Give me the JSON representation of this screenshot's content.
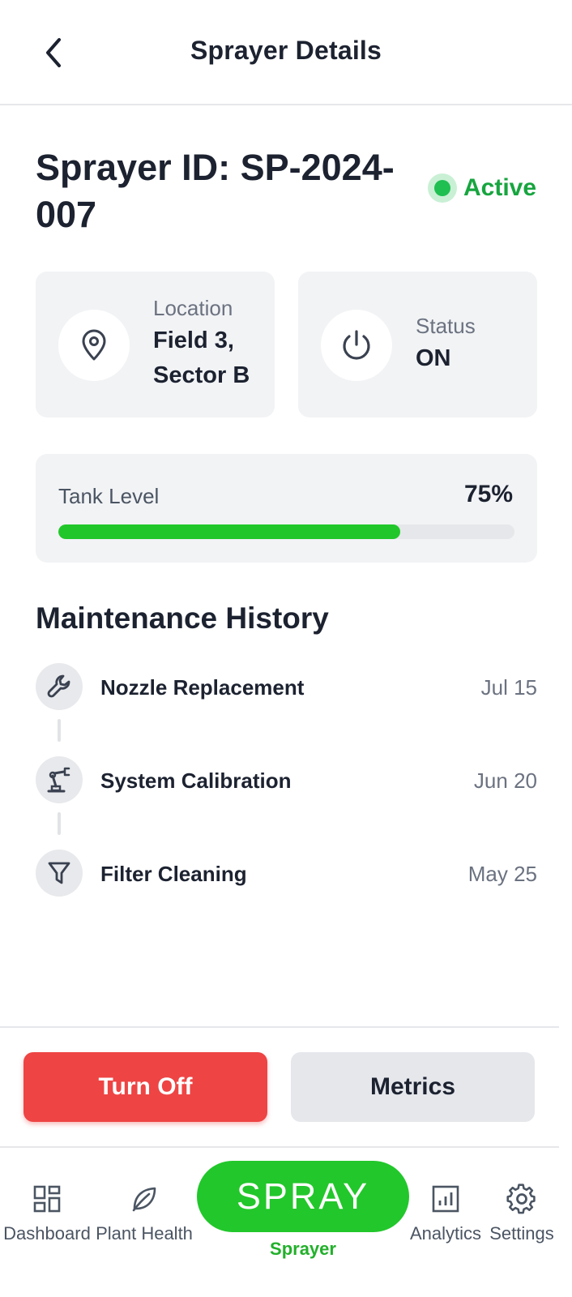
{
  "header": {
    "title": "Sprayer Details",
    "back_icon": "chevron-left-icon"
  },
  "sprayer": {
    "id_text": "Sprayer ID: SP-2024-007",
    "status_badge": "Active",
    "status_color": "#17a53f"
  },
  "cards": {
    "location": {
      "icon": "map-pin-icon",
      "label": "Location",
      "value_line1": "Field 3,",
      "value_line2": "Sector B"
    },
    "status": {
      "icon": "power-icon",
      "label": "Status",
      "value": "ON"
    }
  },
  "tank": {
    "label": "Tank Level",
    "value_text": "75%",
    "level": 0.75,
    "fill_color": "#21c72a"
  },
  "maintenance": {
    "title": "Maintenance History",
    "items": [
      {
        "icon": "wrench-icon",
        "name": "Nozzle Replacement",
        "date": "Jul 15"
      },
      {
        "icon": "robot-arm-icon",
        "name": "System Calibration",
        "date": "Jun 20"
      },
      {
        "icon": "filter-icon",
        "name": "Filter Cleaning",
        "date": "May 25"
      }
    ]
  },
  "actions": {
    "turn_off": "Turn Off",
    "metrics": "Metrics",
    "turn_off_color": "#ee4444"
  },
  "nav": {
    "items": [
      {
        "icon": "dashboard-icon",
        "label": "Dashboard"
      },
      {
        "icon": "leaf-icon",
        "label": "Plant Health"
      },
      {
        "icon": "spray-button",
        "label": "Sprayer",
        "button_text": "SPRAY",
        "active": true
      },
      {
        "icon": "analytics-icon",
        "label": "Analytics"
      },
      {
        "icon": "gear-icon",
        "label": "Settings"
      }
    ],
    "active_color": "#22c72b"
  }
}
